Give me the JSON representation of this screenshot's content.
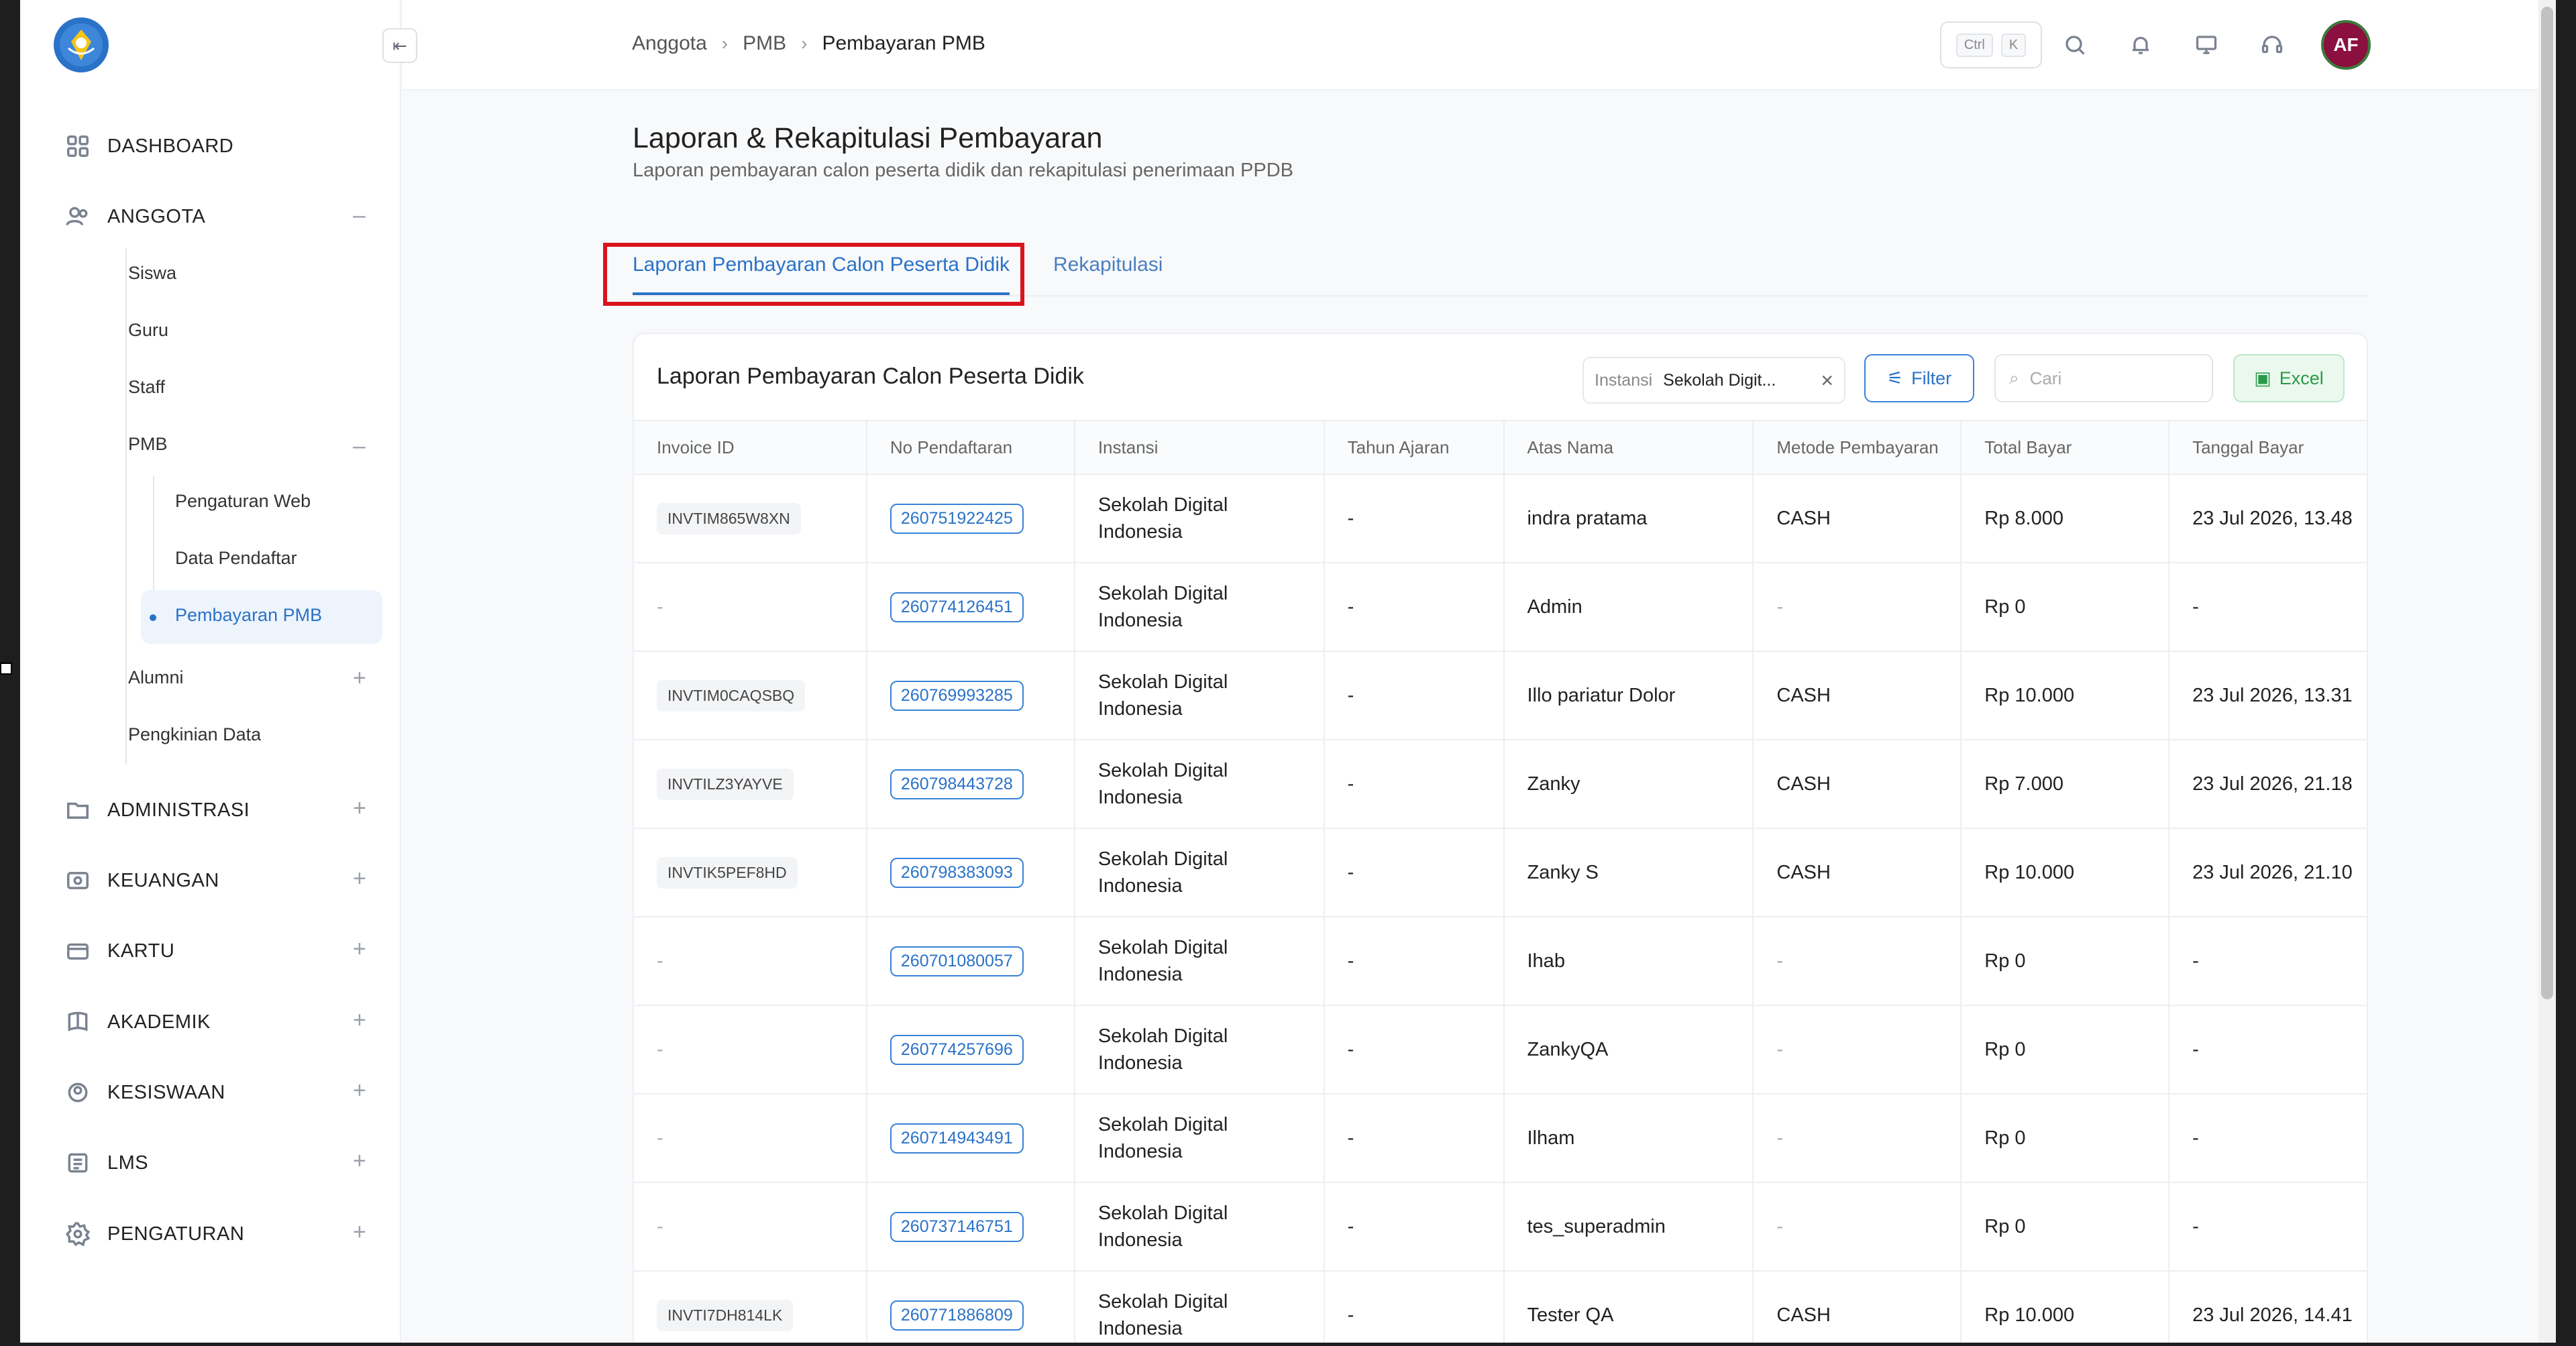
{
  "sidebar": {
    "items": [
      {
        "label": "DASHBOARD",
        "icon": "grid-icon"
      },
      {
        "label": "ANGGOTA",
        "icon": "users-icon",
        "toggle": "–"
      },
      {
        "label": "ADMINISTRASI",
        "icon": "folder-icon",
        "toggle": "+"
      },
      {
        "label": "KEUANGAN",
        "icon": "money-icon",
        "toggle": "+"
      },
      {
        "label": "KARTU",
        "icon": "card-icon",
        "toggle": "+"
      },
      {
        "label": "AKADEMIK",
        "icon": "book-icon",
        "toggle": "+"
      },
      {
        "label": "KESISWAAN",
        "icon": "student-icon",
        "toggle": "+"
      },
      {
        "label": "LMS",
        "icon": "lms-icon",
        "toggle": "+"
      },
      {
        "label": "PENGATURAN",
        "icon": "gear-icon",
        "toggle": "+"
      }
    ],
    "anggota_sub": [
      "Siswa",
      "Guru",
      "Staff",
      "PMB",
      "Alumni",
      "Pengkinian Data"
    ],
    "pmb_toggle": "–",
    "alumni_toggle": "+",
    "pmb_sub": [
      "Pengaturan Web",
      "Data Pendaftar",
      "Pembayaran PMB"
    ]
  },
  "topbar": {
    "breadcrumb": [
      "Anggota",
      "PMB",
      "Pembayaran PMB"
    ],
    "kbd_ctrl": "Ctrl",
    "kbd_k": "K",
    "avatar": "AF"
  },
  "page": {
    "title": "Laporan & Rekapitulasi Pembayaran",
    "subtitle": "Laporan pembayaran calon peserta didik dan rekapitulasi penerimaan PPDB",
    "tabs": [
      "Laporan Pembayaran Calon Peserta Didik",
      "Rekapitulasi"
    ]
  },
  "card": {
    "title": "Laporan Pembayaran Calon Peserta Didik",
    "filter_chip_label": "Instansi",
    "filter_chip_value": "Sekolah Digit...",
    "filter_button": "Filter",
    "search_placeholder": "Cari",
    "excel_button": "Excel",
    "columns": [
      "Invoice ID",
      "No Pendaftaran",
      "Instansi",
      "Tahun Ajaran",
      "Atas Nama",
      "Metode Pembayaran",
      "Total Bayar",
      "Tanggal Bayar"
    ],
    "rows": [
      {
        "invoice": "INVTIM865W8XN",
        "reg": "260751922425",
        "inst1": "Sekolah Digital",
        "inst2": "Indonesia",
        "year": "-",
        "name": "indra pratama",
        "method": "CASH",
        "total": "Rp 8.000",
        "date": "23 Jul 2026, 13.48"
      },
      {
        "invoice": "-",
        "reg": "260774126451",
        "inst1": "Sekolah Digital",
        "inst2": "Indonesia",
        "year": "-",
        "name": "Admin",
        "method": "-",
        "total": "Rp 0",
        "date": "-"
      },
      {
        "invoice": "INVTIM0CAQSBQ",
        "reg": "260769993285",
        "inst1": "Sekolah Digital",
        "inst2": "Indonesia",
        "year": "-",
        "name": "Illo pariatur Dolor",
        "method": "CASH",
        "total": "Rp 10.000",
        "date": "23 Jul 2026, 13.31"
      },
      {
        "invoice": "INVTILZ3YAYVE",
        "reg": "260798443728",
        "inst1": "Sekolah Digital",
        "inst2": "Indonesia",
        "year": "-",
        "name": "Zanky",
        "method": "CASH",
        "total": "Rp 7.000",
        "date": "23 Jul 2026, 21.18"
      },
      {
        "invoice": "INVTIK5PEF8HD",
        "reg": "260798383093",
        "inst1": "Sekolah Digital",
        "inst2": "Indonesia",
        "year": "-",
        "name": "Zanky S",
        "method": "CASH",
        "total": "Rp 10.000",
        "date": "23 Jul 2026, 21.10"
      },
      {
        "invoice": "-",
        "reg": "260701080057",
        "inst1": "Sekolah Digital",
        "inst2": "Indonesia",
        "year": "-",
        "name": "Ihab",
        "method": "-",
        "total": "Rp 0",
        "date": "-"
      },
      {
        "invoice": "-",
        "reg": "260774257696",
        "inst1": "Sekolah Digital",
        "inst2": "Indonesia",
        "year": "-",
        "name": "ZankyQA",
        "method": "-",
        "total": "Rp 0",
        "date": "-"
      },
      {
        "invoice": "-",
        "reg": "260714943491",
        "inst1": "Sekolah Digital",
        "inst2": "Indonesia",
        "year": "-",
        "name": "Ilham",
        "method": "-",
        "total": "Rp 0",
        "date": "-"
      },
      {
        "invoice": "-",
        "reg": "260737146751",
        "inst1": "Sekolah Digital",
        "inst2": "Indonesia",
        "year": "-",
        "name": "tes_superadmin",
        "method": "-",
        "total": "Rp 0",
        "date": "-"
      },
      {
        "invoice": "INVTI7DH814LK",
        "reg": "260771886809",
        "inst1": "Sekolah Digital",
        "inst2": "Indonesia",
        "year": "-",
        "name": "Tester QA",
        "method": "CASH",
        "total": "Rp 10.000",
        "date": "23 Jul 2026, 14.41"
      }
    ]
  },
  "colors": {
    "accent": "#2a72c8",
    "highlight": "#d9141c",
    "excel": "#2b9a48",
    "avatar_bg": "#8b0f3f"
  }
}
